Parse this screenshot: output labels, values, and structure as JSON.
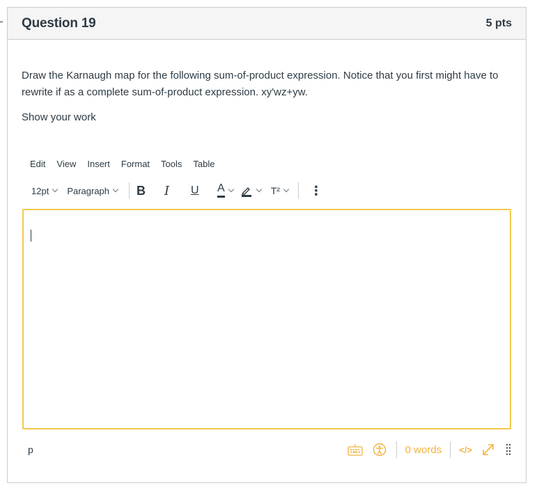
{
  "question": {
    "title": "Question 19",
    "points": "5 pts",
    "prompt": "Draw the Karnaugh map for the following sum-of-product expression. Notice that you first might have to rewrite if as a complete sum-of-product expression.  xy'wz+yw.",
    "instruction": "Show your work"
  },
  "editor": {
    "menu": [
      "Edit",
      "View",
      "Insert",
      "Format",
      "Tools",
      "Table"
    ],
    "font_size": "12pt",
    "block_format": "Paragraph",
    "bold": "B",
    "italic": "I",
    "underline": "U",
    "text_color": "A",
    "superscript": "T²",
    "more": "⋮",
    "path": "p",
    "word_count": "0 words",
    "html_toggle": "</>",
    "accent_color": "#f2c94c"
  }
}
